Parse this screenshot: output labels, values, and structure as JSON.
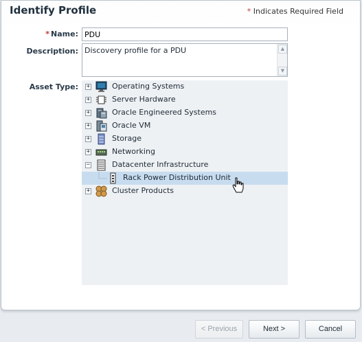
{
  "header": {
    "title": "Identify Profile",
    "required_star": "*",
    "required_note": "Indicates Required Field"
  },
  "form": {
    "name_star": "*",
    "name_label": "Name:",
    "name_value": "PDU",
    "description_label": "Description:",
    "description_value": "Discovery profile for a PDU",
    "asset_type_label": "Asset Type:"
  },
  "tree": {
    "nodes": [
      {
        "label": "Operating Systems",
        "icon": "monitor-icon",
        "expanded": false
      },
      {
        "label": "Server Hardware",
        "icon": "chip-icon",
        "expanded": false
      },
      {
        "label": "Oracle Engineered Systems",
        "icon": "engineered-system-icon",
        "expanded": false
      },
      {
        "label": "Oracle VM",
        "icon": "vm-icon",
        "expanded": false
      },
      {
        "label": "Storage",
        "icon": "storage-icon",
        "expanded": false
      },
      {
        "label": "Networking",
        "icon": "switch-icon",
        "expanded": false
      },
      {
        "label": "Datacenter Infrastructure",
        "icon": "rack-icon",
        "expanded": true
      },
      {
        "label": "Rack Power Distribution Unit",
        "icon": "pdu-icon",
        "selected": true
      },
      {
        "label": "Cluster Products",
        "icon": "cluster-icon",
        "expanded": false
      }
    ]
  },
  "footer": {
    "previous_label": "< Previous",
    "next_label": "Next >",
    "cancel_label": "Cancel"
  },
  "colors": {
    "selection": "#c7dcef",
    "required": "#c0392b",
    "tree_background": "#eef1f4"
  }
}
